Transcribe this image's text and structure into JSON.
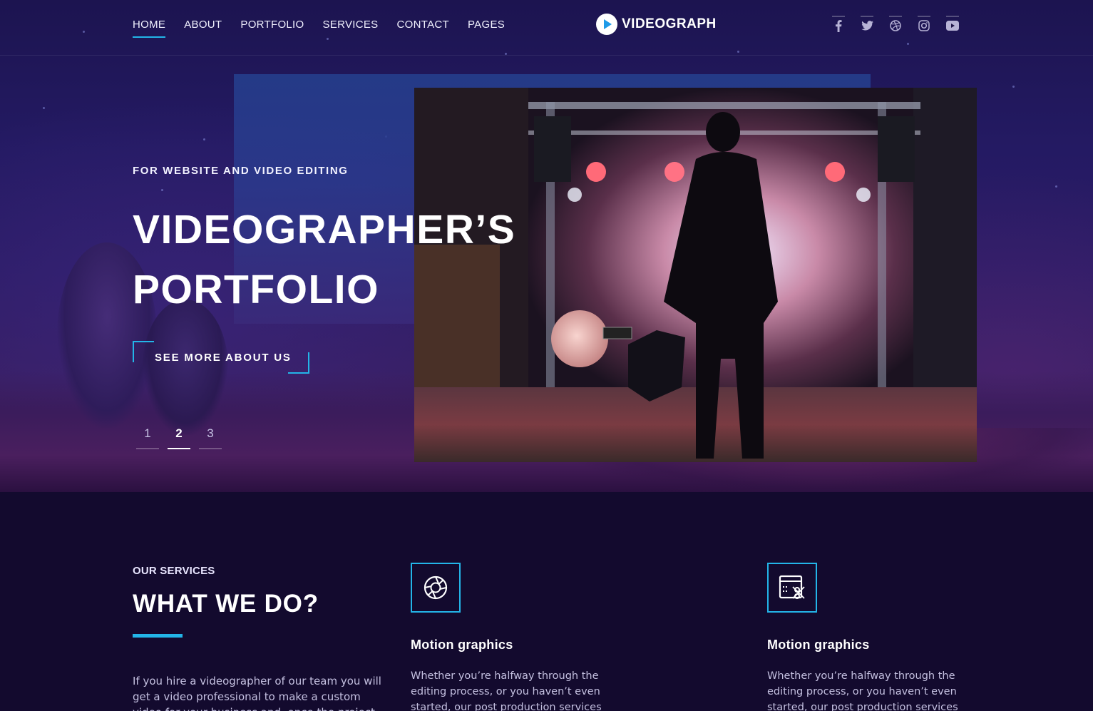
{
  "nav": {
    "links": [
      {
        "label": "HOME"
      },
      {
        "label": "ABOUT"
      },
      {
        "label": "PORTFOLIO"
      },
      {
        "label": "SERVICES"
      },
      {
        "label": "CONTACT"
      },
      {
        "label": "PAGES"
      }
    ],
    "active_index": 0,
    "logo_text": "VIDEOGRAPH",
    "socials": [
      "facebook-icon",
      "twitter-icon",
      "dribbble-icon",
      "instagram-icon",
      "youtube-icon"
    ]
  },
  "hero": {
    "kicker": "FOR WEBSITE AND VIDEO EDITING",
    "title_line1": "VIDEOGRAPHER’S",
    "title_line2": "PORTFOLIO",
    "cta_label": "SEE MORE ABOUT US",
    "pager": [
      "1",
      "2",
      "3"
    ],
    "pager_active": 1
  },
  "services": {
    "kicker": "OUR SERVICES",
    "title": "WHAT WE DO?",
    "description": "If you hire a videographer of our team you will get a video professional to make a custom video for your business and, once the project is over,",
    "cards": [
      {
        "icon": "aperture-icon",
        "title": "Motion graphics",
        "text": "Whether you’re halfway through the editing process, or you haven’t even started, our post production services can put the finishing touches."
      },
      {
        "icon": "video-edit-icon",
        "title": "Motion graphics",
        "text": "Whether you’re halfway through the editing process, or you haven’t even started, our post production services can put the finishing touches."
      }
    ]
  },
  "colors": {
    "accent": "#23b5e8",
    "background": "#130a2e"
  }
}
